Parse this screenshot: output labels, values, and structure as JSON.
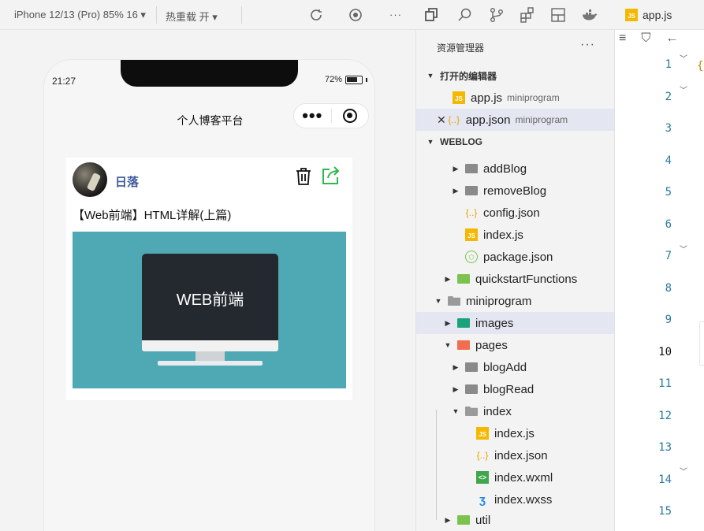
{
  "toolbar": {
    "device": "iPhone 12/13 (Pro) 85% 16 ▾",
    "hot_reload": "热重载 开 ▾",
    "more": "···"
  },
  "simulator": {
    "time": "21:27",
    "battery": "72%",
    "nav_title": "个人博客平台",
    "capsule_dots": "•••",
    "post": {
      "author": "日落",
      "title": "【Web前端】HTML详解(上篇)",
      "cover_text": "WEB前端"
    }
  },
  "explorer": {
    "title": "资源管理器",
    "more": "···",
    "open_editors": "打开的编辑器",
    "open_files": [
      {
        "name": "app.js",
        "sub": "miniprogram"
      },
      {
        "name": "app.json",
        "sub": "miniprogram"
      }
    ],
    "project": "WEBLOG",
    "tree": [
      {
        "label": "addBlog"
      },
      {
        "label": "removeBlog"
      },
      {
        "label": "config.json"
      },
      {
        "label": "index.js"
      },
      {
        "label": "package.json"
      },
      {
        "label": "quickstartFunctions"
      },
      {
        "label": "miniprogram"
      },
      {
        "label": "images"
      },
      {
        "label": "pages"
      },
      {
        "label": "blogAdd"
      },
      {
        "label": "blogRead"
      },
      {
        "label": "index"
      },
      {
        "label": "index.js"
      },
      {
        "label": "index.json"
      },
      {
        "label": "index.wxml"
      },
      {
        "label": "index.wxss"
      },
      {
        "label": "util"
      }
    ]
  },
  "editor": {
    "tab": "app.js",
    "line_numbers": [
      "1",
      "2",
      "3",
      "4",
      "5",
      "6",
      "7",
      "8",
      "9",
      "10",
      "11",
      "12",
      "13",
      "14",
      "15"
    ],
    "first_char": "{"
  },
  "colors": {
    "author": "#3d5a99",
    "share_icon": "#2db84d",
    "cover_bg": "#4fa9b5",
    "selection": "#e4e6f1",
    "line_number": "#2b7a9e"
  }
}
